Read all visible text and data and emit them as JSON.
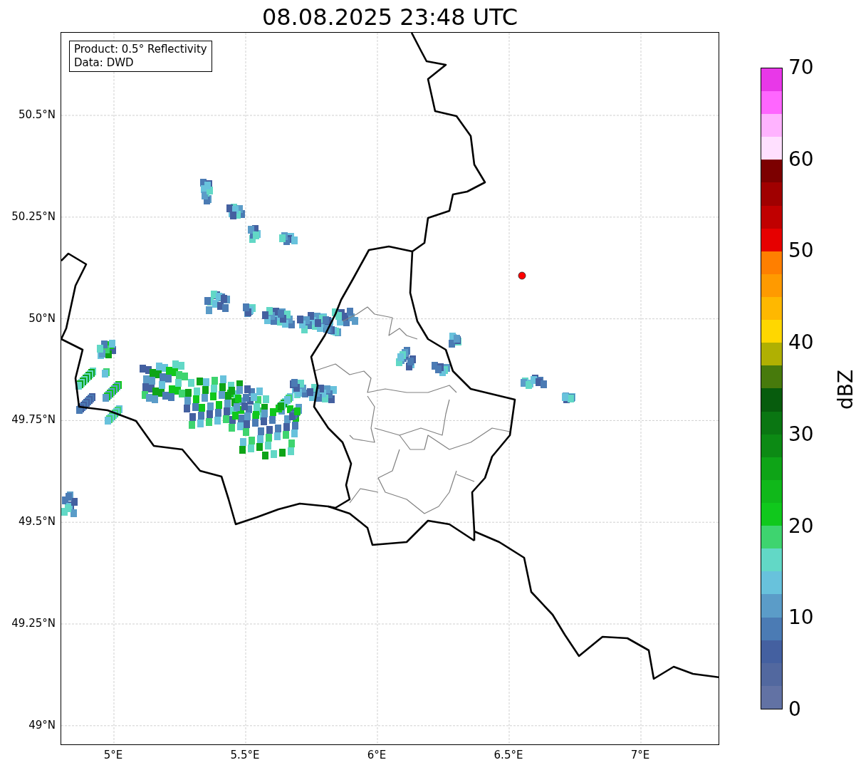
{
  "title": "08.08.2025 23:48 UTC",
  "info_box": [
    "Product: 0.5° Reflectivity",
    "Data: DWD"
  ],
  "map": {
    "x_tick_labels": [
      "5°E",
      "5.5°E",
      "6°E",
      "6.5°E",
      "7°E"
    ],
    "y_tick_labels": [
      "50.5°N",
      "50.25°N",
      "50°N",
      "49.75°N",
      "49.5°N",
      "49.25°N",
      "49°N"
    ]
  },
  "colorbar": {
    "label": "dBZ",
    "tick_labels": [
      "70",
      "60",
      "50",
      "40",
      "30",
      "20",
      "10",
      "0"
    ],
    "segments": [
      {
        "color": "#6272a4"
      },
      {
        "color": "#52689f"
      },
      {
        "color": "#4460a0"
      },
      {
        "color": "#4b7bb4"
      },
      {
        "color": "#5b9cc8"
      },
      {
        "color": "#68c2dc"
      },
      {
        "color": "#62d8c6"
      },
      {
        "color": "#3ed46f"
      },
      {
        "color": "#10c81c"
      },
      {
        "color": "#10b81a"
      },
      {
        "color": "#0ea417"
      },
      {
        "color": "#0c8a14"
      },
      {
        "color": "#0a7612"
      },
      {
        "color": "#075c0d"
      },
      {
        "color": "#477a0c"
      },
      {
        "color": "#b0b002"
      },
      {
        "color": "#ffd700"
      },
      {
        "color": "#ffb800"
      },
      {
        "color": "#ff9a00"
      },
      {
        "color": "#ff7f00"
      },
      {
        "color": "#e60000"
      },
      {
        "color": "#c00000"
      },
      {
        "color": "#a00000"
      },
      {
        "color": "#7c0000"
      },
      {
        "color": "#ffe0ff"
      },
      {
        "color": "#ffb3ff"
      },
      {
        "color": "#ff66ff"
      },
      {
        "color": "#e838e8"
      }
    ]
  }
}
